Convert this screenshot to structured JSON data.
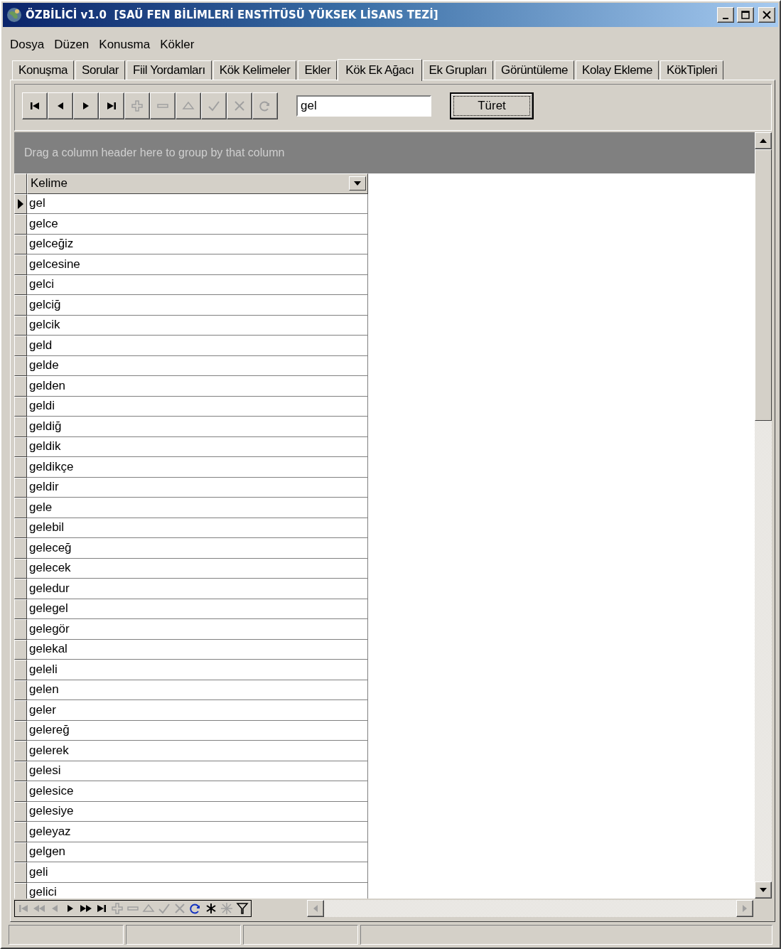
{
  "window": {
    "title": "ÖZBİLİCİ v1.0  [SAÜ FEN BİLİMLERİ ENSTİTÜSÜ YÜKSEK LİSANS TEZİ]"
  },
  "menu": [
    "Dosya",
    "Düzen",
    "Konusma",
    "Kökler"
  ],
  "tabs": [
    {
      "label": "Konuşma",
      "selected": false
    },
    {
      "label": "Sorular",
      "selected": false
    },
    {
      "label": "Fiil Yordamları",
      "selected": false
    },
    {
      "label": "Kök Kelimeler",
      "selected": false
    },
    {
      "label": "Ekler",
      "selected": false
    },
    {
      "label": "Kök Ek Ağacı",
      "selected": true
    },
    {
      "label": "Ek Grupları",
      "selected": false
    },
    {
      "label": "Görüntüleme",
      "selected": false
    },
    {
      "label": "Kolay Ekleme",
      "selected": false
    },
    {
      "label": "KökTipleri",
      "selected": false
    }
  ],
  "toolbar": {
    "buttons": [
      {
        "kind": "first",
        "disabled": false
      },
      {
        "kind": "prior",
        "disabled": false
      },
      {
        "kind": "next",
        "disabled": false
      },
      {
        "kind": "last",
        "disabled": false
      },
      {
        "kind": "insert",
        "disabled": true
      },
      {
        "kind": "delete",
        "disabled": true
      },
      {
        "kind": "edit",
        "disabled": true
      },
      {
        "kind": "post",
        "disabled": true
      },
      {
        "kind": "cancel",
        "disabled": true
      },
      {
        "kind": "refresh",
        "disabled": true
      }
    ],
    "search": {
      "value": "gel"
    },
    "action_button": "Türet"
  },
  "grid": {
    "group_hint": "Drag a column header here to group by that column",
    "columns": [
      "Kelime"
    ],
    "rows": [
      {
        "kelime": "gel",
        "selected": true
      },
      {
        "kelime": "gelce",
        "selected": false
      },
      {
        "kelime": "gelceğiz",
        "selected": false
      },
      {
        "kelime": "gelcesine",
        "selected": false
      },
      {
        "kelime": "gelci",
        "selected": false
      },
      {
        "kelime": "gelciğ",
        "selected": false
      },
      {
        "kelime": "gelcik",
        "selected": false
      },
      {
        "kelime": "geld",
        "selected": false
      },
      {
        "kelime": "gelde",
        "selected": false
      },
      {
        "kelime": "gelden",
        "selected": false
      },
      {
        "kelime": "geldi",
        "selected": false
      },
      {
        "kelime": "geldiğ",
        "selected": false
      },
      {
        "kelime": "geldik",
        "selected": false
      },
      {
        "kelime": "geldikçe",
        "selected": false
      },
      {
        "kelime": "geldir",
        "selected": false
      },
      {
        "kelime": "gele",
        "selected": false
      },
      {
        "kelime": "gelebil",
        "selected": false
      },
      {
        "kelime": "geleceğ",
        "selected": false
      },
      {
        "kelime": "gelecek",
        "selected": false
      },
      {
        "kelime": "geledur",
        "selected": false
      },
      {
        "kelime": "gelegel",
        "selected": false
      },
      {
        "kelime": "gelegör",
        "selected": false
      },
      {
        "kelime": "gelekal",
        "selected": false
      },
      {
        "kelime": "geleli",
        "selected": false
      },
      {
        "kelime": "gelen",
        "selected": false
      },
      {
        "kelime": "geler",
        "selected": false
      },
      {
        "kelime": "gelereğ",
        "selected": false
      },
      {
        "kelime": "gelerek",
        "selected": false
      },
      {
        "kelime": "gelesi",
        "selected": false
      },
      {
        "kelime": "gelesice",
        "selected": false
      },
      {
        "kelime": "gelesiye",
        "selected": false
      },
      {
        "kelime": "geleyaz",
        "selected": false
      },
      {
        "kelime": "gelgen",
        "selected": false
      },
      {
        "kelime": "geli",
        "selected": false
      },
      {
        "kelime": "gelici",
        "selected": false
      }
    ],
    "navigator": [
      {
        "kind": "first",
        "disabled": true
      },
      {
        "kind": "prior-page",
        "disabled": true
      },
      {
        "kind": "prior",
        "disabled": true
      },
      {
        "kind": "next",
        "disabled": false
      },
      {
        "kind": "next-page",
        "disabled": false
      },
      {
        "kind": "last",
        "disabled": false
      },
      {
        "kind": "insert",
        "disabled": true
      },
      {
        "kind": "delete",
        "disabled": true
      },
      {
        "kind": "edit",
        "disabled": true
      },
      {
        "kind": "post",
        "disabled": true
      },
      {
        "kind": "cancel",
        "disabled": true
      },
      {
        "kind": "refresh",
        "disabled": false
      },
      {
        "kind": "bookmark",
        "disabled": false
      },
      {
        "kind": "gear",
        "disabled": true
      },
      {
        "kind": "filter",
        "disabled": false
      }
    ]
  }
}
